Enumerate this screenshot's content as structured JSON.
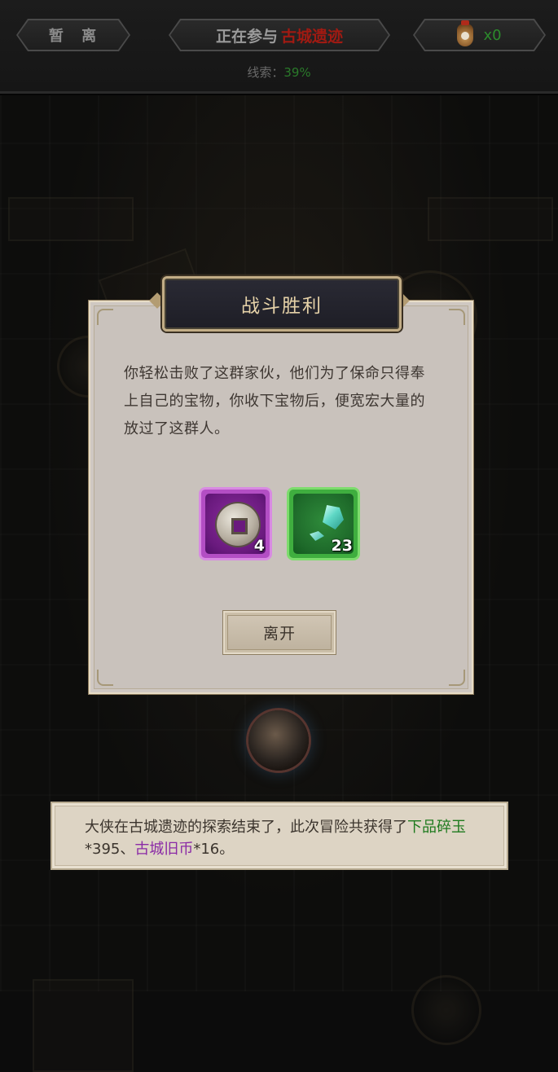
{
  "topbar": {
    "leave_label": "暂 离",
    "participating_label": "正在参与",
    "location_name": "古城遗迹",
    "item_count": "x0",
    "clue_label": "线索：",
    "clue_percent": "39%"
  },
  "dialog": {
    "title": "战斗胜利",
    "message": "你轻松击败了这群家伙，他们为了保命只得奉上自己的宝物，你收下宝物后，便宽宏大量的放过了这群人。",
    "rewards": [
      {
        "icon": "ancient-coin-icon",
        "quantity": "4",
        "rarity_color": "#b34ec4"
      },
      {
        "icon": "jade-shard-icon",
        "quantity": "23",
        "rarity_color": "#3fae3f"
      }
    ],
    "leave_button": "离开"
  },
  "notice": {
    "prefix": "大侠在古城遗迹的探索结束了，此次冒险共获得了",
    "item1_name": "下品碎玉",
    "item1_qty": "*395、",
    "item2_name": "古城旧币",
    "item2_qty": "*16。"
  },
  "colors": {
    "location_red": "#a11a12",
    "clue_green": "#2a7a2a",
    "rarity_purple": "#8a2aa6",
    "rarity_green": "#1e7a1e"
  }
}
